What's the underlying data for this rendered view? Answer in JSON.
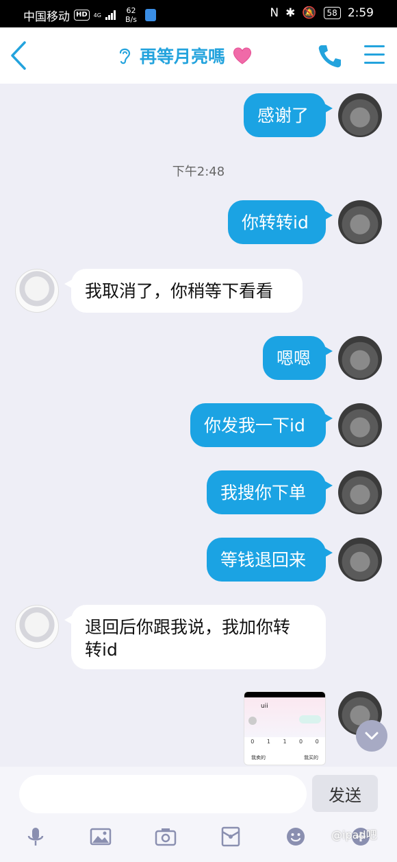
{
  "status_bar": {
    "carrier": "中国移动",
    "hd": "HD",
    "network": "4G",
    "speed_value": "62",
    "speed_unit": "B/s",
    "battery": "58",
    "time": "2:59"
  },
  "header": {
    "title": "再等月亮嗎"
  },
  "messages": [
    {
      "side": "me",
      "text": "感谢了"
    },
    {
      "side": "me",
      "text": "你转转id"
    },
    {
      "side": "other",
      "text": "我取消了，你稍等下看看"
    },
    {
      "side": "me",
      "text": "嗯嗯"
    },
    {
      "side": "me",
      "text": "你发我一下id"
    },
    {
      "side": "me",
      "text": "我搜你下单"
    },
    {
      "side": "me",
      "text": "等钱退回来"
    },
    {
      "side": "other",
      "text_line1": "退回后你跟我说，我加你转",
      "text_line2": "转id"
    }
  ],
  "timestamp": "下午2:48",
  "thumbnail": {
    "username": "uii",
    "stats": [
      "0",
      "1",
      "1",
      "0",
      "0"
    ],
    "link_left": "我卖的",
    "link_right": "我买的"
  },
  "composer": {
    "placeholder": "",
    "send_label": "发送"
  },
  "watermark": "@ipad吧",
  "colors": {
    "accent": "#1ba3e3",
    "title": "#23a3dd",
    "background": "#eeeef6"
  }
}
